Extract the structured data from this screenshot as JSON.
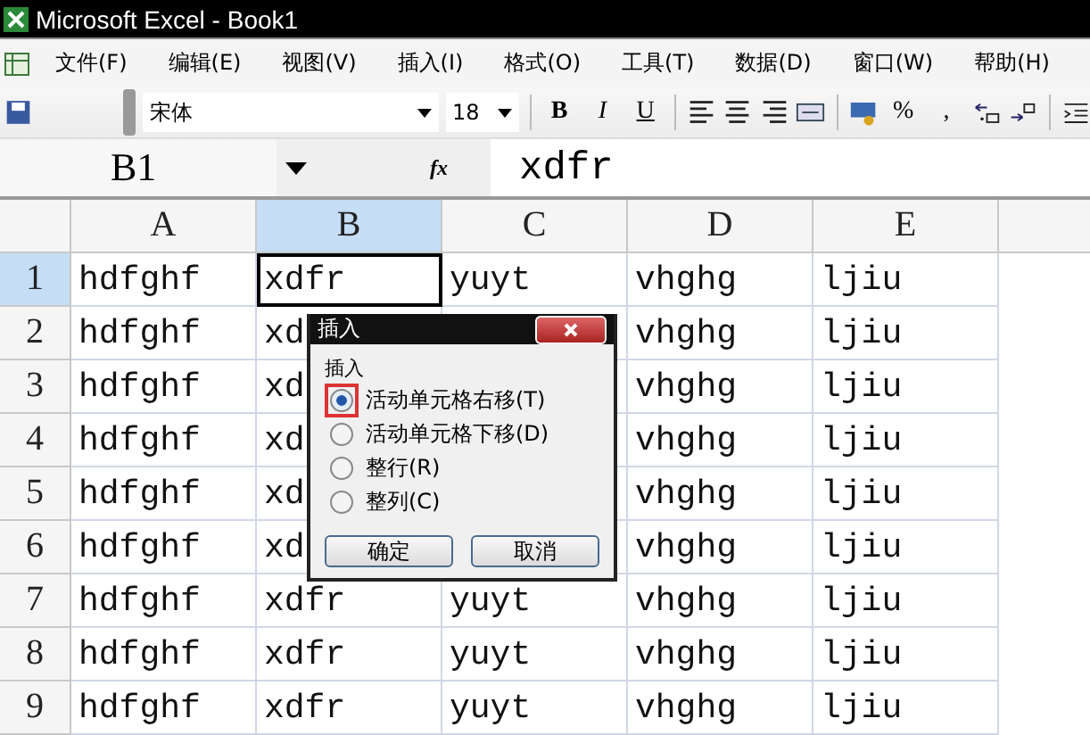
{
  "window": {
    "title": "Microsoft Excel - Book1"
  },
  "menu": [
    "文件(F)",
    "编辑(E)",
    "视图(V)",
    "插入(I)",
    "格式(O)",
    "工具(T)",
    "数据(D)",
    "窗口(W)",
    "帮助(H)"
  ],
  "toolbar": {
    "font": "宋体",
    "size": "18",
    "style_buttons": [
      "B",
      "I",
      "U"
    ],
    "number_buttons": [
      "%",
      ","
    ]
  },
  "formula_bar": {
    "name_box": "B1",
    "function_label": "fx",
    "value": "xdfr"
  },
  "sheet": {
    "columns": [
      {
        "label": "A",
        "selected": false
      },
      {
        "label": "B",
        "selected": true
      },
      {
        "label": "C",
        "selected": false
      },
      {
        "label": "D",
        "selected": false
      },
      {
        "label": "E",
        "selected": false
      }
    ],
    "rows": [
      {
        "label": "1",
        "selected": true,
        "cells": [
          {
            "text": "hdfghf",
            "active": false
          },
          {
            "text": "xdfr",
            "active": true
          },
          {
            "text": "yuyt",
            "active": false
          },
          {
            "text": "vhghg",
            "active": false
          },
          {
            "text": "ljiu",
            "active": false
          }
        ]
      },
      {
        "label": "2",
        "selected": false,
        "cells": [
          {
            "text": "hdfghf",
            "active": false
          },
          {
            "text": "xd",
            "active": false
          },
          {
            "active": false
          },
          {
            "text": "vhghg",
            "active": false
          },
          {
            "text": "ljiu",
            "active": false
          }
        ]
      },
      {
        "label": "3",
        "selected": false,
        "cells": [
          {
            "text": "hdfghf",
            "active": false
          },
          {
            "text": "xd",
            "active": false
          },
          {
            "active": false
          },
          {
            "text": "vhghg",
            "active": false
          },
          {
            "text": "ljiu",
            "active": false
          }
        ]
      },
      {
        "label": "4",
        "selected": false,
        "cells": [
          {
            "text": "hdfghf",
            "active": false
          },
          {
            "text": "xd",
            "active": false
          },
          {
            "active": false
          },
          {
            "text": "vhghg",
            "active": false
          },
          {
            "text": "ljiu",
            "active": false
          }
        ]
      },
      {
        "label": "5",
        "selected": false,
        "cells": [
          {
            "text": "hdfghf",
            "active": false
          },
          {
            "text": "xd",
            "active": false
          },
          {
            "active": false
          },
          {
            "text": "vhghg",
            "active": false
          },
          {
            "text": "ljiu",
            "active": false
          }
        ]
      },
      {
        "label": "6",
        "selected": false,
        "cells": [
          {
            "text": "hdfghf",
            "active": false
          },
          {
            "text": "xd",
            "active": false
          },
          {
            "active": false
          },
          {
            "text": "vhghg",
            "active": false
          },
          {
            "text": "ljiu",
            "active": false
          }
        ]
      },
      {
        "label": "7",
        "selected": false,
        "cells": [
          {
            "text": "hdfghf",
            "active": false
          },
          {
            "text": "xdfr",
            "active": false
          },
          {
            "text": "yuyt",
            "active": false
          },
          {
            "text": "vhghg",
            "active": false
          },
          {
            "text": "ljiu",
            "active": false
          }
        ]
      },
      {
        "label": "8",
        "selected": false,
        "cells": [
          {
            "text": "hdfghf",
            "active": false
          },
          {
            "text": "xdfr",
            "active": false
          },
          {
            "text": "yuyt",
            "active": false
          },
          {
            "text": "vhghg",
            "active": false
          },
          {
            "text": "ljiu",
            "active": false
          }
        ]
      },
      {
        "label": "9",
        "selected": false,
        "cells": [
          {
            "text": "hdfghf",
            "active": false
          },
          {
            "text": "xdfr",
            "active": false
          },
          {
            "text": "yuyt",
            "active": false
          },
          {
            "text": "vhghg",
            "active": false
          },
          {
            "text": "ljiu",
            "active": false
          }
        ]
      }
    ]
  },
  "dialog": {
    "title": "插入",
    "group_label": "插入",
    "options": [
      {
        "label": "活动单元格右移(T)",
        "selected": true,
        "highlighted": true
      },
      {
        "label": "活动单元格下移(D)",
        "selected": false,
        "highlighted": false
      },
      {
        "label": "整行(R)",
        "selected": false,
        "highlighted": false
      },
      {
        "label": "整列(C)",
        "selected": false,
        "highlighted": false
      }
    ],
    "buttons": [
      "确定",
      "取消"
    ]
  }
}
